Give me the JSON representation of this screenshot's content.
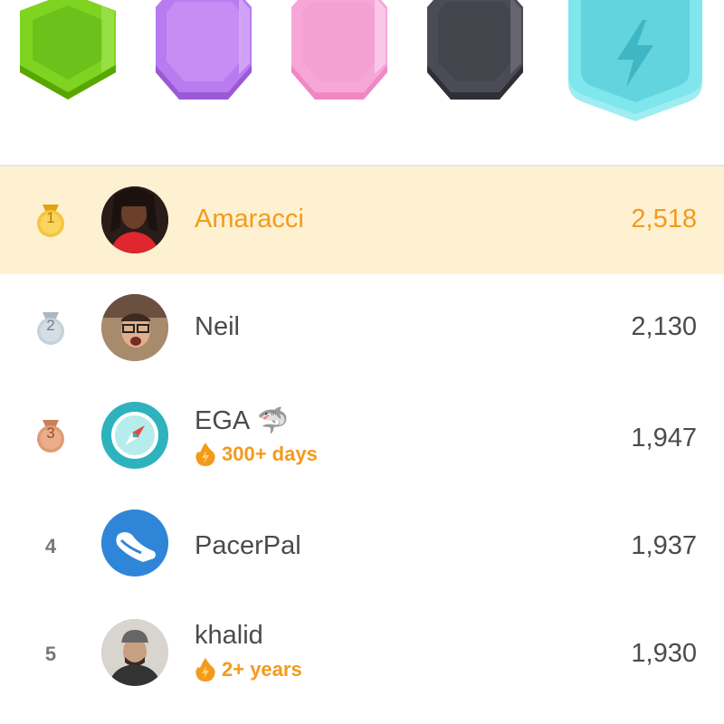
{
  "league_badges": [
    {
      "name": "emerald",
      "color": "#7fd321"
    },
    {
      "name": "amethyst",
      "color": "#b87cf0"
    },
    {
      "name": "pearl",
      "color": "#f6a7d8"
    },
    {
      "name": "obsidian",
      "color": "#4b4b55"
    },
    {
      "name": "diamond",
      "color": "#7ee6ec",
      "icon": "lightning-bolt-icon"
    }
  ],
  "leaderboard": [
    {
      "rank": "1",
      "name": "Amaracci",
      "score": "2,518",
      "highlight": true,
      "medal": "gold"
    },
    {
      "rank": "2",
      "name": "Neil",
      "score": "2,130",
      "medal": "silver"
    },
    {
      "rank": "3",
      "name": "EGA",
      "score": "1,947",
      "medal": "bronze",
      "badge_icon": "shark-icon",
      "streak": "300+ days"
    },
    {
      "rank": "4",
      "name": "PacerPal",
      "score": "1,937"
    },
    {
      "rank": "5",
      "name": "khalid",
      "score": "1,930",
      "streak": "2+ years"
    }
  ],
  "colors": {
    "highlight_bg": "#fdf1d2",
    "accent": "#f49a1b",
    "text": "#4b4b4b"
  }
}
